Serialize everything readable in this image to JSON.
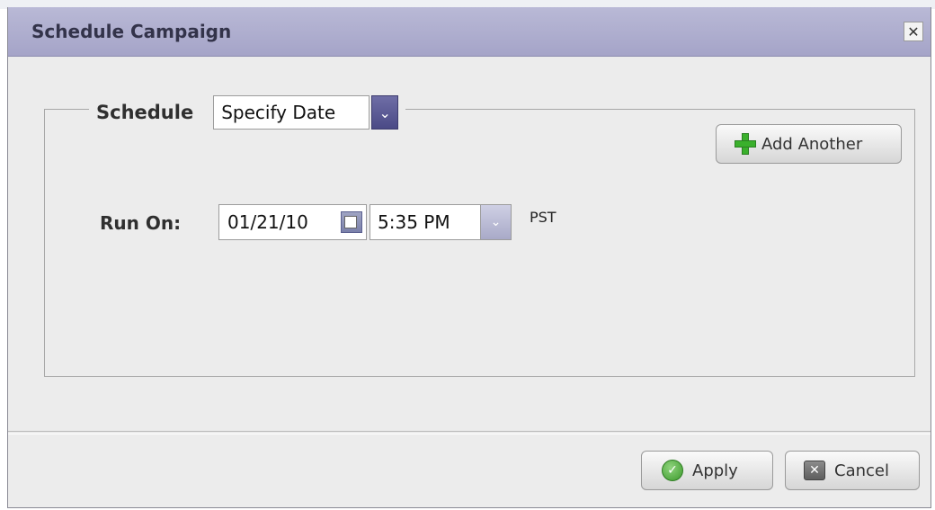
{
  "dialog": {
    "title": "Schedule Campaign",
    "close_glyph": "✕"
  },
  "schedule": {
    "label": "Schedule",
    "selected": "Specify Date",
    "arrow_glyph": "⌄"
  },
  "add_another": {
    "label": "Add Another",
    "icon": "plus-icon"
  },
  "run_on": {
    "label": "Run On:",
    "date": "01/21/10",
    "time": "5:35 PM",
    "timezone": "PST",
    "time_arrow_glyph": "⌄"
  },
  "footer": {
    "apply_label": "Apply",
    "apply_icon_glyph": "✓",
    "cancel_label": "Cancel",
    "cancel_icon_glyph": "✕"
  },
  "colors": {
    "titlebar": "#a5a4c8",
    "dialog_bg": "#ececec",
    "accent": "#4b4a86",
    "plus_green": "#3ab02c"
  }
}
